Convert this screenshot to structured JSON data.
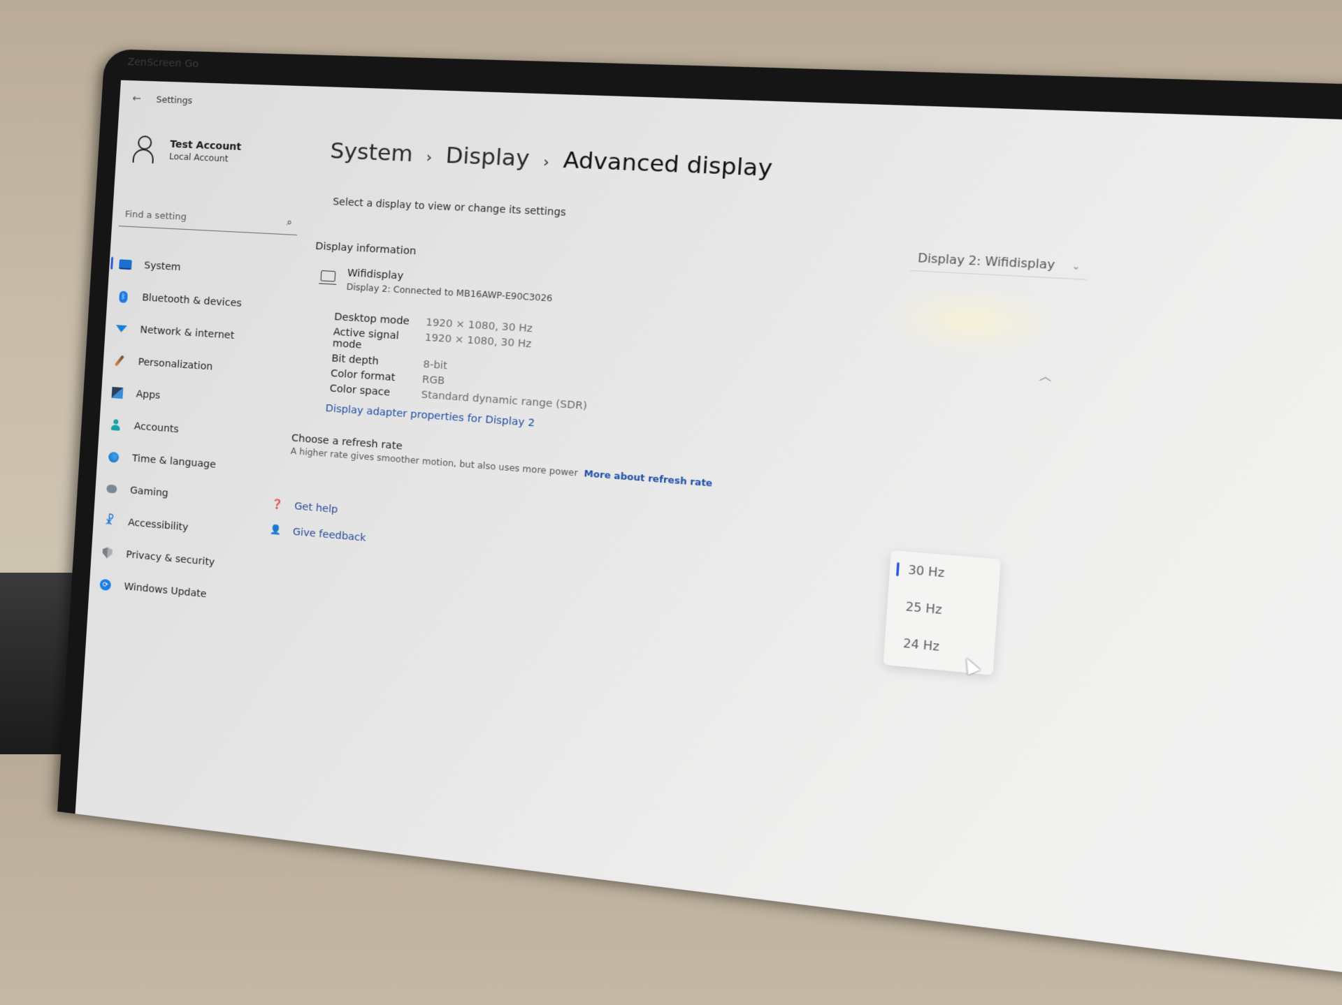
{
  "monitor": {
    "brand_label": "ZenScreen Go"
  },
  "window": {
    "title": "Settings",
    "back_icon": "arrow-left-icon"
  },
  "account": {
    "name": "Test Account",
    "type": "Local Account",
    "icon": "person-icon"
  },
  "search": {
    "placeholder": "Find a setting",
    "icon": "search-icon"
  },
  "sidebar": {
    "items": [
      {
        "label": "System",
        "icon": "system-icon",
        "active": true
      },
      {
        "label": "Bluetooth & devices",
        "icon": "bluetooth-icon"
      },
      {
        "label": "Network & internet",
        "icon": "wifi-icon"
      },
      {
        "label": "Personalization",
        "icon": "brush-icon"
      },
      {
        "label": "Apps",
        "icon": "apps-icon"
      },
      {
        "label": "Accounts",
        "icon": "accounts-icon"
      },
      {
        "label": "Time & language",
        "icon": "globe-clock-icon"
      },
      {
        "label": "Gaming",
        "icon": "gamepad-icon"
      },
      {
        "label": "Accessibility",
        "icon": "accessibility-icon"
      },
      {
        "label": "Privacy & security",
        "icon": "shield-icon"
      },
      {
        "label": "Windows Update",
        "icon": "update-icon"
      }
    ]
  },
  "header": {
    "breadcrumb": [
      "System",
      "Display",
      "Advanced display"
    ],
    "separator": "›",
    "subtitle": "Select a display to view or change its settings"
  },
  "display_select": {
    "value": "Display 2: Wifidisplay",
    "icon": "chevron-down-icon"
  },
  "display_information": {
    "section_title": "Display information",
    "display_name": "Wifidisplay",
    "display_detail": "Display 2: Connected to MB16AWP-E90C3026",
    "rows": [
      {
        "key": "Desktop mode",
        "value": "1920 × 1080, 30 Hz"
      },
      {
        "key": "Active signal mode",
        "value": "1920 × 1080, 30 Hz"
      },
      {
        "key": "Bit depth",
        "value": "8-bit"
      },
      {
        "key": "Color format",
        "value": "RGB"
      },
      {
        "key": "Color space",
        "value": "Standard dynamic range (SDR)"
      }
    ],
    "adapter_link": "Display adapter properties for Display 2",
    "collapse_icon": "chevron-up-icon"
  },
  "refresh_rate": {
    "title": "Choose a refresh rate",
    "description": "A higher rate gives smoother motion, but also uses more power",
    "link": "More about refresh rate",
    "options": [
      "30 Hz",
      "25 Hz",
      "24 Hz"
    ],
    "selected": "30 Hz"
  },
  "help": {
    "get_help": "Get help",
    "give_feedback": "Give feedback"
  },
  "colors": {
    "accent": "#2a5bd7",
    "link": "#1f4fa8"
  }
}
